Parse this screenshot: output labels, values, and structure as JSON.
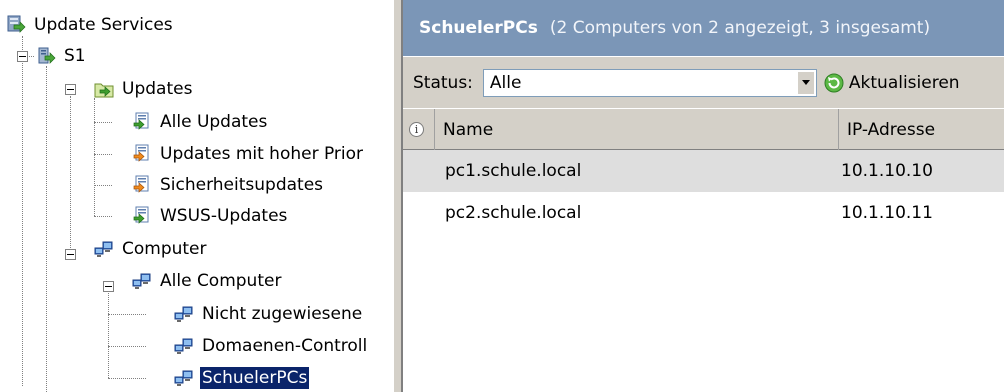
{
  "tree": {
    "root_label": "Update Services",
    "server_label": "S1",
    "updates_label": "Updates",
    "update_items": [
      "Alle Updates",
      "Updates mit hoher Prior",
      "Sicherheitsupdates",
      "WSUS-Updates"
    ],
    "computer_label": "Computer",
    "all_computers_label": "Alle Computer",
    "group_items": [
      "Nicht zugewiesene",
      "Domaenen-Controll",
      "SchuelerPCs"
    ],
    "selected_item": "SchuelerPCs"
  },
  "panel": {
    "title": "SchuelerPCs",
    "subtitle": "(2 Computers von 2 angezeigt, 3 insgesamt)"
  },
  "toolbar": {
    "status_label": "Status:",
    "status_value": "Alle",
    "refresh_label": "Aktualisieren"
  },
  "table": {
    "columns": [
      "Name",
      "IP-Adresse"
    ],
    "rows": [
      {
        "name": "pc1.schule.local",
        "ip": "10.1.10.10"
      },
      {
        "name": "pc2.schule.local",
        "ip": "10.1.10.11"
      }
    ]
  },
  "colors": {
    "title_bar": "#7b96b7",
    "selection": "#0a246a",
    "row_highlight": "#dedede",
    "chrome": "#d4d0c8"
  },
  "icons": {
    "root": "update-services-icon",
    "server": "server-icon",
    "updates": "updates-folder-icon",
    "update_item": "update-doc-icon",
    "computers": "computer-group-icon",
    "refresh": "refresh-icon",
    "info": "info-icon"
  }
}
